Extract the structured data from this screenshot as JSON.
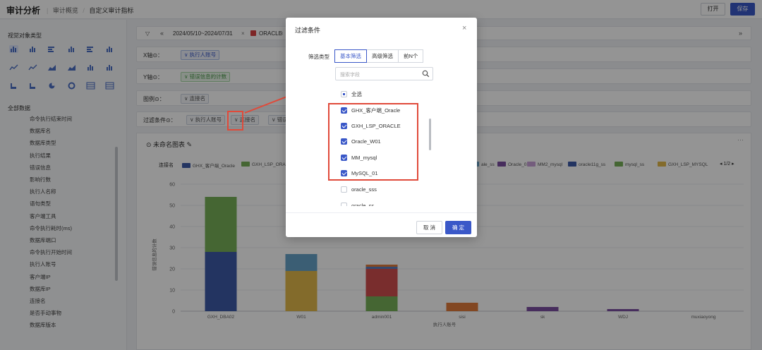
{
  "header": {
    "title": "审计分析",
    "breadcrumb": [
      "审计概览",
      "自定义审计指标"
    ],
    "open_label": "打开",
    "save_label": "保存"
  },
  "sidebar": {
    "vis_title": "视觉对象类型",
    "vis_icons": [
      "grouped-bar-icon",
      "stacked-bar-icon",
      "horizontal-bar-icon",
      "percent-bar-icon",
      "horizontal-stacked-bar-icon",
      "column-icon",
      "line-icon",
      "smooth-line-icon",
      "area-icon",
      "stacked-area-icon",
      "combo-bar-line-icon",
      "waterfall-icon",
      "scatter-icon",
      "funnel-icon",
      "pie-icon",
      "donut-icon",
      "table-icon",
      "matrix-icon"
    ],
    "all_data_title": "全部数据",
    "fields": [
      "命令执行结束时间",
      "数据库名",
      "数据库类型",
      "执行结果",
      "错误信息",
      "影响行数",
      "执行人名称",
      "语句类型",
      "客户端工具",
      "命令执行耗时(ms)",
      "数据库端口",
      "命令执行开始时间",
      "执行人账号",
      "客户端IP",
      "数据库IP",
      "连接名",
      "是否手动事物",
      "数据库版本"
    ]
  },
  "toolbar": {
    "date_range": "2024/05/10~2024/07/31",
    "close": "×",
    "db_type": "ORACLE",
    "collapse_left": "«",
    "expand_right": "»"
  },
  "config": {
    "x_label": "X轴⊙：",
    "x_field": "∨ 执行人账号",
    "y_label": "Y轴⊙：",
    "y_field": "∨ 错误信息的计数",
    "legend_label": "图例⊙：",
    "legend_field": "∨ 连接名",
    "filter_label": "过滤条件⊙：",
    "filter_fields": [
      "∨ 执行人账号",
      "∨ 连接名",
      "∨ 错误"
    ]
  },
  "chart_card": {
    "title": "⊙ 未命名图表 ✎",
    "more": "···",
    "legend_label": "连接名",
    "page": "◂ 1/2 ▸"
  },
  "chart_data": {
    "type": "bar",
    "stacked": true,
    "xlabel": "执行人账号",
    "ylabel": "错误信息的计数",
    "ylim": [
      0,
      60
    ],
    "yticks": [
      0,
      10,
      20,
      30,
      40,
      50,
      60
    ],
    "grid": true,
    "categories": [
      "GXH_DBA02",
      "W01",
      "admin001",
      "sisi",
      "sk",
      "WDJ",
      "muxiaoyong"
    ],
    "series": [
      {
        "name": "GHX_客户端_Oracle",
        "color": "#3d5aa8",
        "values": [
          28,
          0,
          0,
          0,
          0,
          0,
          0
        ]
      },
      {
        "name": "GXH_LSP_ORACLE",
        "color": "#78b058",
        "values": [
          26,
          0,
          7,
          0,
          0,
          0,
          0
        ]
      },
      {
        "name": "Oracle_W01",
        "color": "#e2b84a",
        "values": [
          0,
          19,
          0,
          0,
          0,
          0,
          0
        ]
      },
      {
        "name": "MM_mysql",
        "color": "#66a2c8",
        "values": [
          0,
          8,
          0,
          0,
          0,
          0,
          0
        ]
      },
      {
        "name": "MySQL_01",
        "color": "#d04e4e",
        "values": [
          0,
          0,
          13,
          0,
          0,
          0,
          0
        ]
      },
      {
        "name": "oracle_sss",
        "color": "#5a7fc0",
        "values": [
          0,
          0,
          1,
          0,
          0,
          0,
          0
        ]
      },
      {
        "name": "oracle_ss",
        "color": "#e07a3c",
        "values": [
          0,
          0,
          1,
          4,
          0,
          0,
          0
        ]
      },
      {
        "name": "Oracle_01",
        "color": "#7b4ea0",
        "values": [
          0,
          0,
          0,
          0,
          2,
          1,
          0
        ]
      }
    ],
    "visible_legend": [
      {
        "name": "GHX_客户端_Oracle",
        "color": "#3d5aa8"
      },
      {
        "name": "GXH_LSP_ORA",
        "color": "#78b058"
      },
      {
        "name": "ale_ss",
        "color": "#66a2c8"
      },
      {
        "name": "Oracle_01",
        "color": "#7b4ea0"
      },
      {
        "name": "MM2_mysql",
        "color": "#c8a0d8"
      },
      {
        "name": "oracle11g_ss",
        "color": "#3d5aa8"
      },
      {
        "name": "mysql_ss",
        "color": "#78b058"
      },
      {
        "name": "GXH_LSP_MYSQL",
        "color": "#e2b84a"
      }
    ]
  },
  "modal": {
    "title": "过滤条件",
    "close": "×",
    "filter_type_label": "筛选类型",
    "tabs": [
      "基本筛选",
      "高级筛选",
      "前N个"
    ],
    "active_tab": 0,
    "search_placeholder": "搜索字段",
    "select_all": "全选",
    "options": [
      {
        "label": "GHX_客户端_Oracle",
        "checked": true
      },
      {
        "label": "GXH_LSP_ORACLE",
        "checked": true
      },
      {
        "label": "Oracle_W01",
        "checked": true
      },
      {
        "label": "MM_mysql",
        "checked": true
      },
      {
        "label": "MySQL_01",
        "checked": true
      },
      {
        "label": "oracle_sss",
        "checked": false
      },
      {
        "label": "oracle_ss",
        "checked": false
      }
    ],
    "cancel_label": "取 消",
    "ok_label": "确 定"
  },
  "colors": {
    "accent": "#3a58c8",
    "highlight": "#e04a3a"
  }
}
